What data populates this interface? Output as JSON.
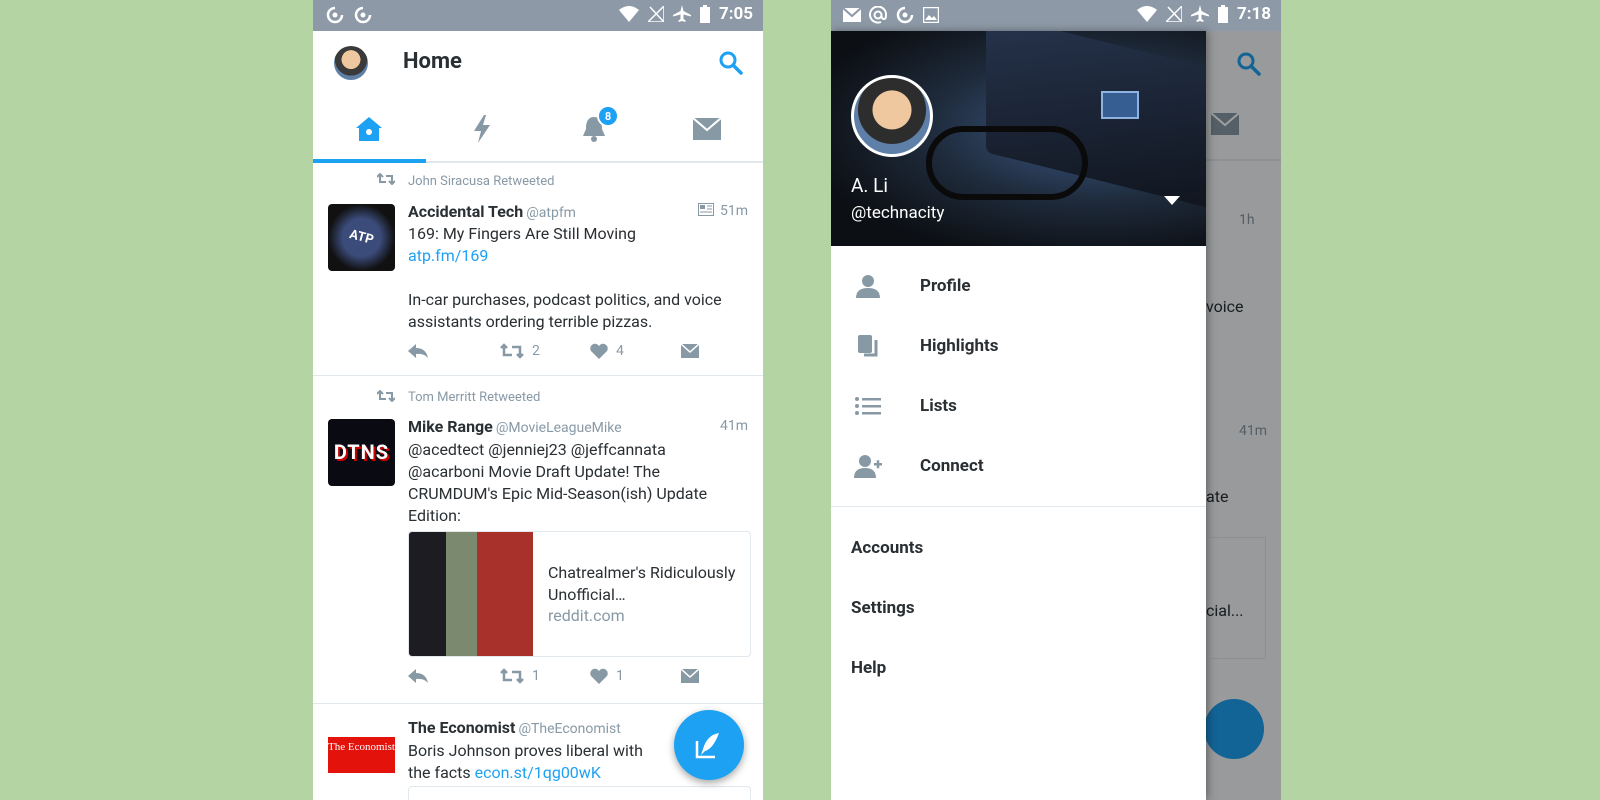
{
  "left_screen": {
    "status": {
      "time": "7:05"
    },
    "header": {
      "title": "Home"
    },
    "tabs": {
      "notification_badge": "8"
    },
    "tweets": [
      {
        "retweeted_by": "John Siracusa Retweeted",
        "avatar_text": "ATP",
        "name": "Accidental Tech",
        "handle": "@atpfm",
        "time": "51m",
        "text": "169: My Fingers Are Still Moving",
        "link": "atp.fm/169",
        "text2": "In-car purchases, podcast politics, and voice assistants ordering terrible pizzas.",
        "retweets": "2",
        "likes": "4"
      },
      {
        "retweeted_by": "Tom Merritt Retweeted",
        "avatar_text": "DTNS",
        "name": "Mike Range",
        "handle": "@MovieLeagueMike",
        "time": "41m",
        "text": "@acedtect @jenniej23 @jeffcannata @acarboni Movie Draft Update! The CRUMDUM's Epic Mid-Season(ish) Update Edition:",
        "card_title": "Chatrealmer's Ridiculously Unofficial…",
        "card_domain": "reddit.com",
        "retweets": "1",
        "likes": "1"
      },
      {
        "avatar_text": "The Economist",
        "name": "The Economist",
        "handle": "@TheEconomist",
        "text": "Boris Johnson proves liberal with the facts",
        "link": "econ.st/1qg00wK"
      }
    ]
  },
  "right_screen": {
    "status": {
      "time": "7:18"
    },
    "drawer": {
      "name": "A. Li",
      "handle": "@technacity",
      "menu": [
        "Profile",
        "Highlights",
        "Lists",
        "Connect"
      ],
      "secondary": [
        "Accounts",
        "Settings",
        "Help"
      ]
    },
    "background": {
      "time1": "1h",
      "text1": "voice",
      "time2": "41m",
      "text2": "ate",
      "text3": "cial..."
    }
  }
}
